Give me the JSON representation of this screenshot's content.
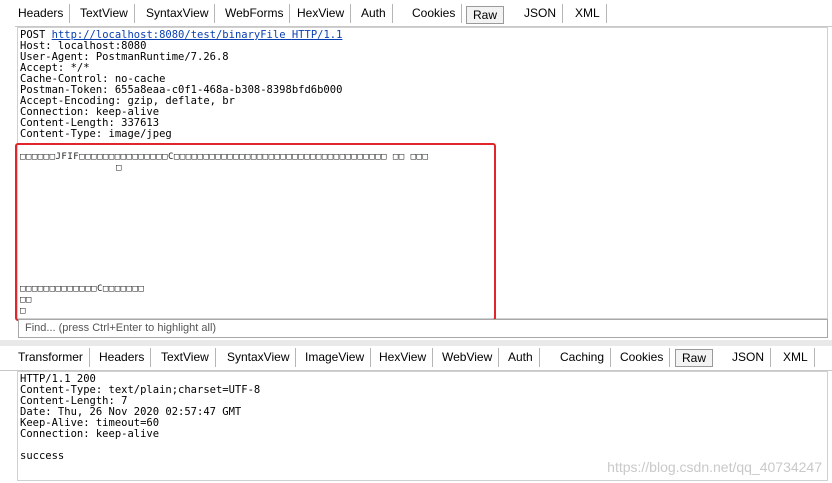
{
  "request_tabs": [
    "Headers",
    "TextView",
    "SyntaxView",
    "WebForms",
    "HexView",
    "Auth",
    "Cookies",
    "Raw",
    "JSON",
    "XML"
  ],
  "request_active_tab": "Raw",
  "request": {
    "method": "POST",
    "url": "http://localhost:8080/test/binaryFile",
    "protocol": "HTTP/1.1",
    "headers": [
      "Host: localhost:8080",
      "User-Agent: PostmanRuntime/7.26.8",
      "Accept: */*",
      "Cache-Control: no-cache",
      "Postman-Token: 655a8eaa-c0f1-468a-b308-8398bfd6b000",
      "Accept-Encoding: gzip, deflate, br",
      "Connection: keep-alive",
      "Content-Length: 337613",
      "Content-Type: image/jpeg"
    ],
    "binary_line1": "□□□□□□JFIF□□□□□□□□□□□□□□□C□□□□□□□□□□□□□□□□□□□□□□□□□□□□□□□□□□□□ □□ □□□",
    "binary_line2": "□",
    "binary_line3": "□□□□□□□□□□□□□C□□□□□□□",
    "binary_line4": "□□",
    "binary_line5": "□"
  },
  "find_placeholder": "Find... (press Ctrl+Enter to highlight all)",
  "response_tabs": [
    "Transformer",
    "Headers",
    "TextView",
    "SyntaxView",
    "ImageView",
    "HexView",
    "WebView",
    "Auth",
    "Caching",
    "Cookies",
    "Raw",
    "JSON",
    "XML"
  ],
  "response_active_tab": "Raw",
  "response": {
    "lines": [
      "HTTP/1.1 200",
      "Content-Type: text/plain;charset=UTF-8",
      "Content-Length: 7",
      "Date: Thu, 26 Nov 2020 02:57:47 GMT",
      "Keep-Alive: timeout=60",
      "Connection: keep-alive"
    ],
    "body": "success"
  },
  "watermark": "https://blog.csdn.net/qq_40734247",
  "colors": {
    "highlight_box": "#e0262b",
    "link": "#0a3fb2"
  }
}
